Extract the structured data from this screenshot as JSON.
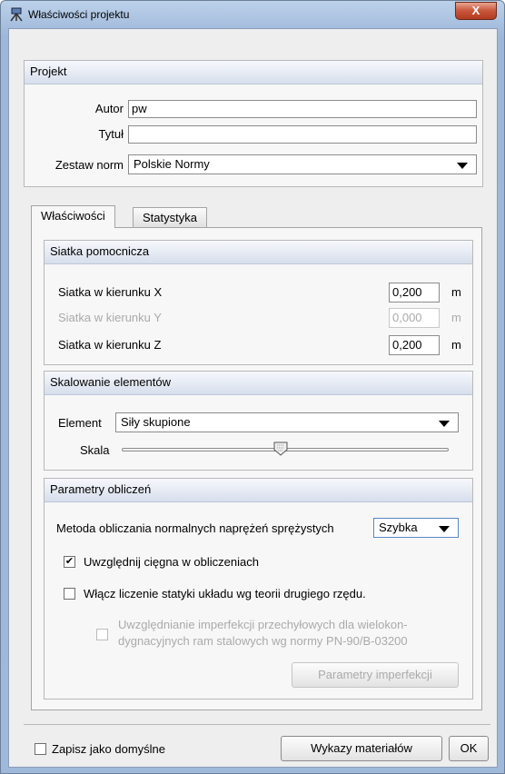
{
  "window": {
    "title": "Właściwości projektu",
    "close_label": "X"
  },
  "project": {
    "header": "Projekt",
    "author_label": "Autor",
    "author_value": "pw",
    "title_label": "Tytuł",
    "title_value": "",
    "norms_label": "Zestaw norm",
    "norms_value": "Polskie Normy"
  },
  "tabs": [
    {
      "label": "Właściwości",
      "active": true
    },
    {
      "label": "Statystyka",
      "active": false
    }
  ],
  "grid": {
    "header": "Siatka pomocnicza",
    "rows": [
      {
        "label": "Siatka w kierunku X",
        "value": "0,200",
        "unit": "m",
        "enabled": true
      },
      {
        "label": "Siatka w kierunku Y",
        "value": "0,000",
        "unit": "m",
        "enabled": false
      },
      {
        "label": "Siatka w kierunku Z",
        "value": "0,200",
        "unit": "m",
        "enabled": true
      }
    ]
  },
  "scaling": {
    "header": "Skalowanie elementów",
    "element_label": "Element",
    "element_value": "Siły skupione",
    "scale_label": "Skala",
    "scale_position": 0.49
  },
  "params": {
    "header": "Parametry obliczeń",
    "method_label": "Metoda obliczania normalnych naprężeń sprężystych",
    "method_value": "Szybka",
    "tendons_label": "Uwzględnij cięgna w obliczeniach",
    "tendons_checked": true,
    "second_order_label": "Włącz liczenie statyki układu wg teorii drugiego rzędu.",
    "second_order_checked": false,
    "imperfection_label_1": "Uwzględnianie imperfekcji przechyłowych dla wielokon-",
    "imperfection_label_2": "dygnacyjnych ram stalowych wg normy PN-90/B-03200",
    "imperfection_checked": false,
    "imperfection_button": "Parametry imperfekcji"
  },
  "footer": {
    "save_default_label": "Zapisz jako domyślne",
    "save_default_checked": false,
    "materials_button": "Wykazy materiałów",
    "ok_button": "OK"
  },
  "colors": {
    "title_bar": "#a9c2e2",
    "close_button": "#c8553a",
    "panel_header": "#dde4ef"
  }
}
